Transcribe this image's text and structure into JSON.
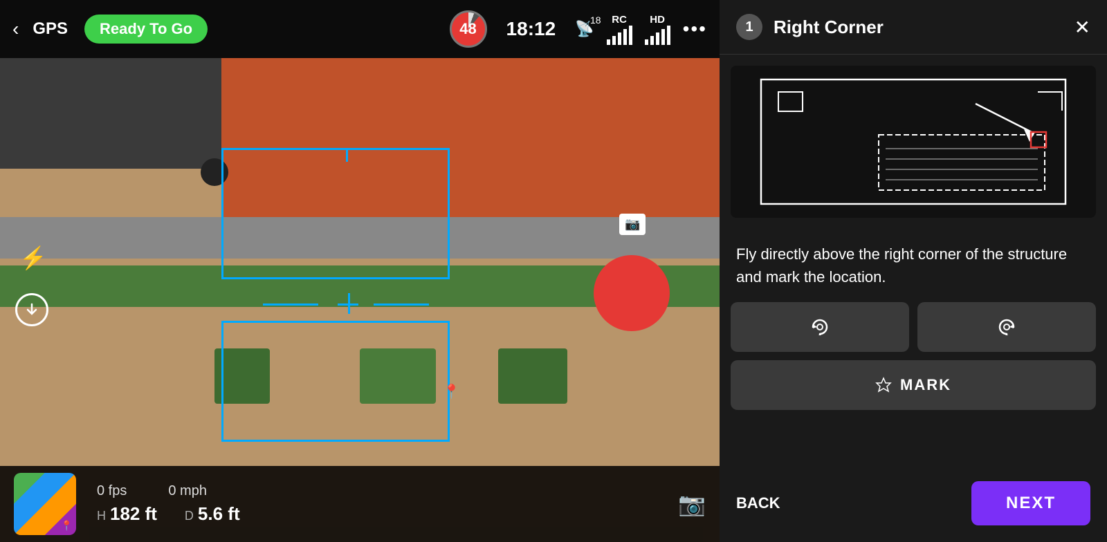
{
  "header": {
    "back_label": "‹",
    "gps_label": "GPS",
    "ready_label": "Ready To Go",
    "battery": "48",
    "time": "18:12",
    "wifi_sup": "18",
    "rc_label": "RC",
    "hd_label": "HD",
    "more_label": "•••"
  },
  "panel": {
    "step": "1",
    "title": "Right Corner",
    "close_label": "✕",
    "instruction": "Fly directly above the right corner of the structure and mark the location.",
    "mark_label": "MARK",
    "back_label": "BACK",
    "next_label": "NEXT"
  },
  "stats": {
    "fps_label": "0 fps",
    "mph_label": "0 mph",
    "h_label": "H",
    "h_value": "182 ft",
    "d_label": "D",
    "d_value": "5.6 ft"
  }
}
